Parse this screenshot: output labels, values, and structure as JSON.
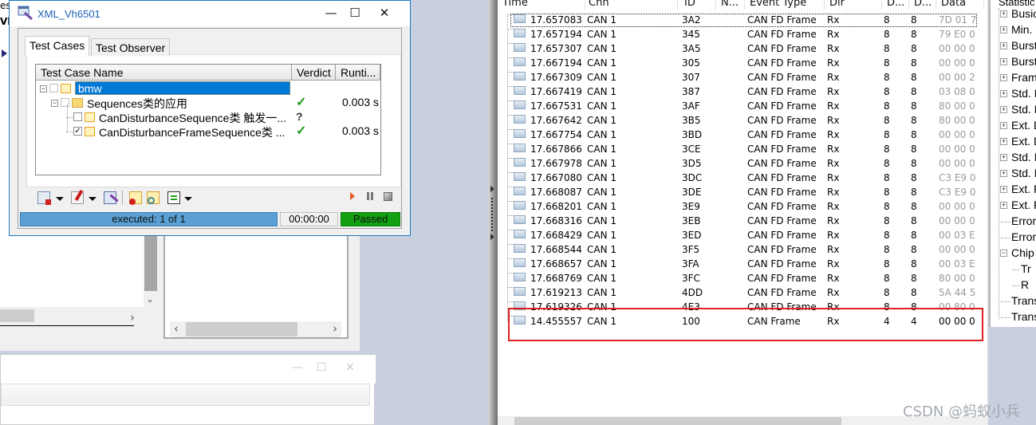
{
  "xml_window": {
    "title": "XML_Vh6501",
    "controls": {
      "minimize": "—",
      "maximize": "☐",
      "close": "✕"
    },
    "tabs": [
      {
        "label": "Test Cases",
        "active": true
      },
      {
        "label": "Test Observer",
        "active": false
      }
    ],
    "columns": [
      "Test Case Name",
      "Verdict",
      "Runti..."
    ],
    "tree": [
      {
        "level": 0,
        "name": "bmw",
        "checked": true,
        "selected": true,
        "verdict": "",
        "runtime": ""
      },
      {
        "level": 1,
        "name": "Sequences类的应用",
        "checked": true,
        "verdict": "pass",
        "verdict_glyph": "✓",
        "runtime": "0.003 s"
      },
      {
        "level": 2,
        "name": "CanDisturbanceSequence类 触发一...",
        "checked": false,
        "verdict": "unknown",
        "verdict_glyph": "?",
        "runtime": ""
      },
      {
        "level": 2,
        "name": "CanDisturbanceFrameSequence类 ...",
        "checked": true,
        "verdict": "pass",
        "verdict_glyph": "✓",
        "runtime": "0.003 s"
      }
    ],
    "toolbar": {
      "play": "▶",
      "pause": "⏸",
      "stop": "■"
    },
    "status": {
      "progress_text": "executed: 1 of 1",
      "progress_fraction": 1.0,
      "elapsed": "00:00:00",
      "verdict": "Passed",
      "verdict_color": "#12a012"
    }
  },
  "trace": {
    "columns": [
      "Time",
      "Chn",
      "ID",
      "N...",
      "Event Type",
      "Dir",
      "D...",
      "D...",
      "Data"
    ],
    "rows": [
      {
        "time": "17.657083",
        "chn": "CAN 1",
        "id": "3A2",
        "name": "",
        "event": "CAN FD Frame",
        "dir": "Rx",
        "dlc": "8",
        "len": "8",
        "data": "7D 01 7"
      },
      {
        "time": "17.657194",
        "chn": "CAN 1",
        "id": "345",
        "name": "",
        "event": "CAN FD Frame",
        "dir": "Rx",
        "dlc": "8",
        "len": "8",
        "data": "79 E0 0"
      },
      {
        "time": "17.657307",
        "chn": "CAN 1",
        "id": "3A5",
        "name": "",
        "event": "CAN FD Frame",
        "dir": "Rx",
        "dlc": "8",
        "len": "8",
        "data": "00 00 0"
      },
      {
        "time": "17.667194",
        "chn": "CAN 1",
        "id": "305",
        "name": "",
        "event": "CAN FD Frame",
        "dir": "Rx",
        "dlc": "8",
        "len": "8",
        "data": "00 00 0"
      },
      {
        "time": "17.667309",
        "chn": "CAN 1",
        "id": "307",
        "name": "",
        "event": "CAN FD Frame",
        "dir": "Rx",
        "dlc": "8",
        "len": "8",
        "data": "00 00 2"
      },
      {
        "time": "17.667419",
        "chn": "CAN 1",
        "id": "387",
        "name": "",
        "event": "CAN FD Frame",
        "dir": "Rx",
        "dlc": "8",
        "len": "8",
        "data": "03 08 0"
      },
      {
        "time": "17.667531",
        "chn": "CAN 1",
        "id": "3AF",
        "name": "",
        "event": "CAN FD Frame",
        "dir": "Rx",
        "dlc": "8",
        "len": "8",
        "data": "80 00 0"
      },
      {
        "time": "17.667642",
        "chn": "CAN 1",
        "id": "3B5",
        "name": "",
        "event": "CAN FD Frame",
        "dir": "Rx",
        "dlc": "8",
        "len": "8",
        "data": "80 00 0"
      },
      {
        "time": "17.667754",
        "chn": "CAN 1",
        "id": "3BD",
        "name": "",
        "event": "CAN FD Frame",
        "dir": "Rx",
        "dlc": "8",
        "len": "8",
        "data": "00 00 0"
      },
      {
        "time": "17.667866",
        "chn": "CAN 1",
        "id": "3CE",
        "name": "",
        "event": "CAN FD Frame",
        "dir": "Rx",
        "dlc": "8",
        "len": "8",
        "data": "00 00 0"
      },
      {
        "time": "17.667978",
        "chn": "CAN 1",
        "id": "3D5",
        "name": "",
        "event": "CAN FD Frame",
        "dir": "Rx",
        "dlc": "8",
        "len": "8",
        "data": "00 00 0"
      },
      {
        "time": "17.667080",
        "chn": "CAN 1",
        "id": "3DC",
        "name": "",
        "event": "CAN FD Frame",
        "dir": "Rx",
        "dlc": "8",
        "len": "8",
        "data": "C3 E9 0"
      },
      {
        "time": "17.668087",
        "chn": "CAN 1",
        "id": "3DE",
        "name": "",
        "event": "CAN FD Frame",
        "dir": "Rx",
        "dlc": "8",
        "len": "8",
        "data": "C3 E9 0"
      },
      {
        "time": "17.668201",
        "chn": "CAN 1",
        "id": "3E9",
        "name": "",
        "event": "CAN FD Frame",
        "dir": "Rx",
        "dlc": "8",
        "len": "8",
        "data": "00 00 0"
      },
      {
        "time": "17.668316",
        "chn": "CAN 1",
        "id": "3EB",
        "name": "",
        "event": "CAN FD Frame",
        "dir": "Rx",
        "dlc": "8",
        "len": "8",
        "data": "00 00 0"
      },
      {
        "time": "17.668429",
        "chn": "CAN 1",
        "id": "3ED",
        "name": "",
        "event": "CAN FD Frame",
        "dir": "Rx",
        "dlc": "8",
        "len": "8",
        "data": "00 03 E"
      },
      {
        "time": "17.668544",
        "chn": "CAN 1",
        "id": "3F5",
        "name": "",
        "event": "CAN FD Frame",
        "dir": "Rx",
        "dlc": "8",
        "len": "8",
        "data": "00 00 0"
      },
      {
        "time": "17.668657",
        "chn": "CAN 1",
        "id": "3FA",
        "name": "",
        "event": "CAN FD Frame",
        "dir": "Rx",
        "dlc": "8",
        "len": "8",
        "data": "00 03 E"
      },
      {
        "time": "17.668769",
        "chn": "CAN 1",
        "id": "3FC",
        "name": "",
        "event": "CAN FD Frame",
        "dir": "Rx",
        "dlc": "8",
        "len": "8",
        "data": "80 00 0"
      },
      {
        "time": "17.619213",
        "chn": "CAN 1",
        "id": "4DD",
        "name": "",
        "event": "CAN FD Frame",
        "dir": "Rx",
        "dlc": "8",
        "len": "8",
        "data": "5A 44 5"
      },
      {
        "time": "17.619326",
        "chn": "CAN 1",
        "id": "4E3",
        "name": "",
        "event": "CAN FD Frame",
        "dir": "Rx",
        "dlc": "8",
        "len": "8",
        "data": "00 80 0"
      },
      {
        "time": "14.455557",
        "chn": "CAN 1",
        "id": "100",
        "name": "",
        "event": "CAN Frame",
        "dir": "Rx",
        "dlc": "4",
        "len": "4",
        "data": "00 00 0",
        "highlighted": true
      }
    ]
  },
  "statistics": {
    "header": "Statistic",
    "items": [
      {
        "label": "Busio",
        "expandable": true
      },
      {
        "label": "Min. S",
        "expandable": true
      },
      {
        "label": "Burst",
        "expandable": true
      },
      {
        "label": "Burst",
        "expandable": true
      },
      {
        "label": "Fram",
        "expandable": true
      },
      {
        "label": "Std. D",
        "expandable": true
      },
      {
        "label": "Std. D",
        "expandable": true
      },
      {
        "label": "Ext. D",
        "expandable": true
      },
      {
        "label": "Ext. D",
        "expandable": true
      },
      {
        "label": "Std. F",
        "expandable": true
      },
      {
        "label": "Std. F",
        "expandable": true
      },
      {
        "label": "Ext. F",
        "expandable": true
      },
      {
        "label": "Ext. F",
        "expandable": true
      },
      {
        "label": "Error",
        "expandable": false
      },
      {
        "label": "Error",
        "expandable": false
      },
      {
        "label": "Chip",
        "expandable": true,
        "expanded": true
      },
      {
        "label": "Tr",
        "expandable": false,
        "child": true
      },
      {
        "label": "R",
        "expandable": false,
        "child": true
      },
      {
        "label": "Trans",
        "expandable": false
      },
      {
        "label": "Trans",
        "expandable": false
      }
    ]
  },
  "background": {
    "left_fragments": [
      "est",
      "Vh"
    ],
    "second_window_controls": {
      "minimize": "—",
      "maximize": "☐",
      "close": "✕"
    },
    "scroll_glyphs": {
      "left": "‹",
      "right": "›",
      "down": "⌄"
    }
  },
  "watermark": "CSDN @蚂蚁小兵",
  "colors": {
    "selection": "#0078d7",
    "highlight_box": "#e02020",
    "progress": "#5aa0d4",
    "passed": "#12a012"
  }
}
